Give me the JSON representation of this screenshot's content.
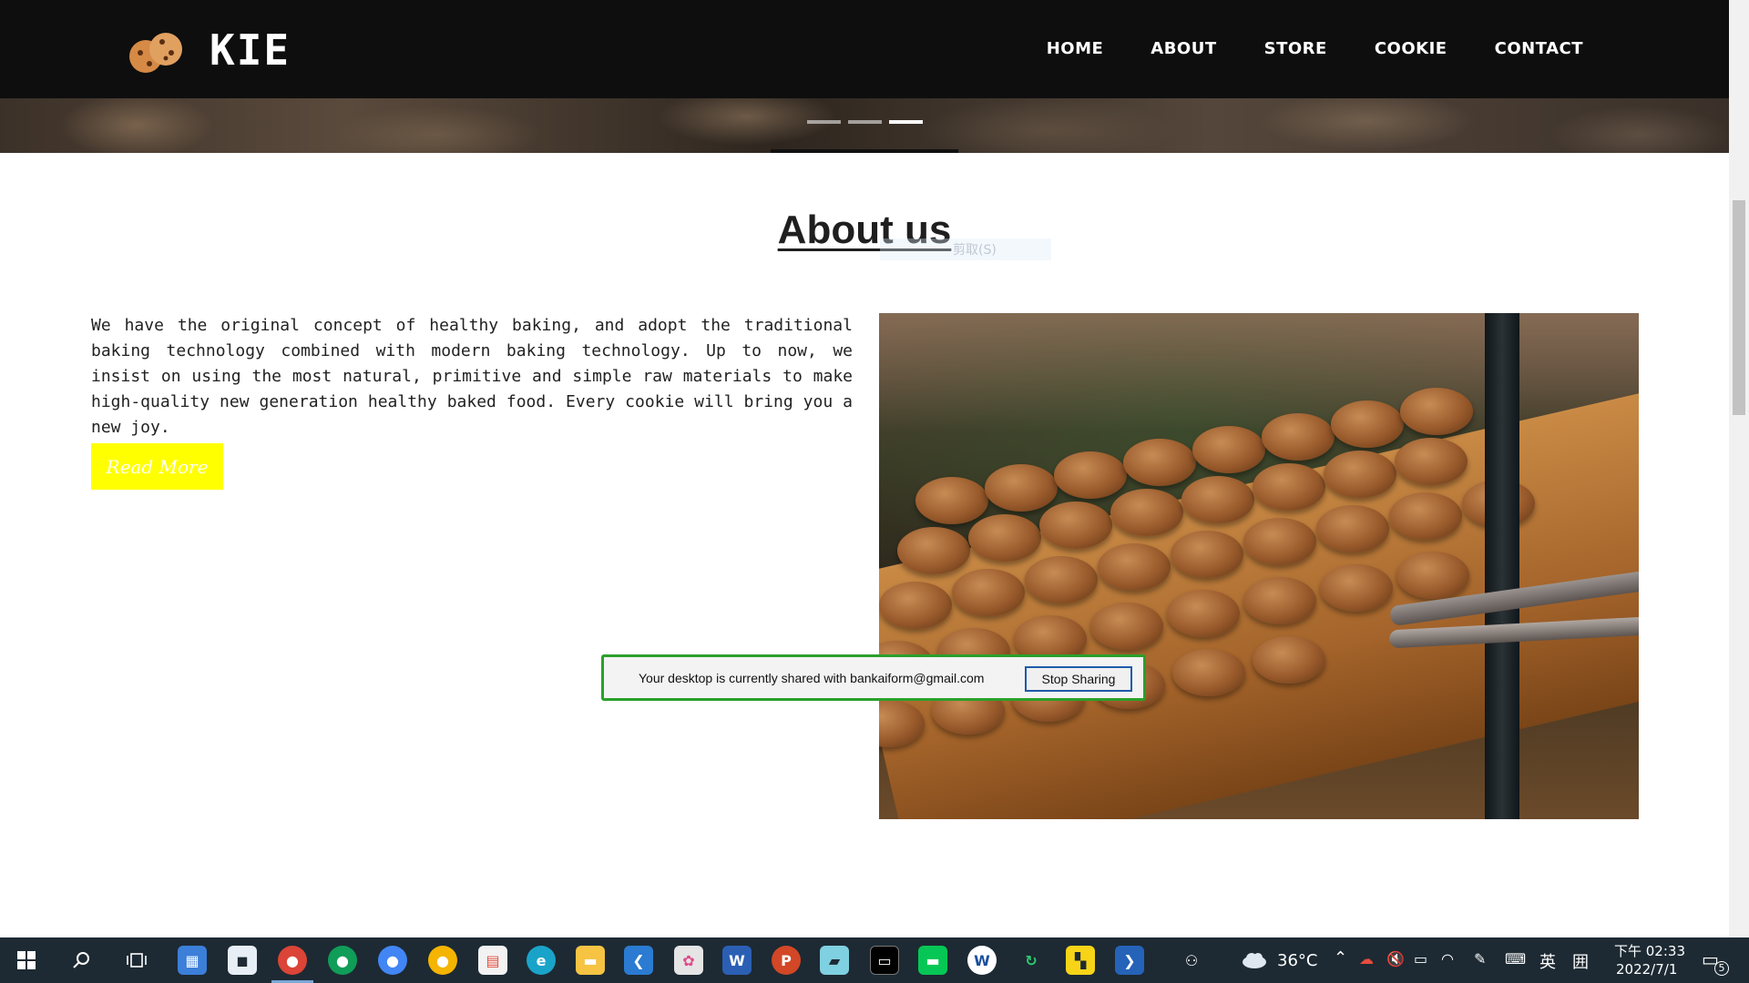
{
  "site": {
    "brand": "KIE",
    "nav": [
      "HOME",
      "ABOUT",
      "STORE",
      "COOKIE",
      "CONTACT"
    ],
    "logo_icon": "cookie-icon"
  },
  "hero": {
    "slides_total": 3,
    "active_slide": 3
  },
  "about": {
    "title": "About us",
    "ghost_tooltip": "剪取(S)",
    "text": "We have the original concept of healthy baking, and adopt the traditional baking technology combined with modern baking technology. Up to now, we insist on using the most natural, primitive and simple raw materials to make high-quality new generation healthy baked food. Every cookie will bring you a new joy.",
    "read_more": "Read More",
    "accent_color": "#ffff00"
  },
  "share_bar": {
    "message": "Your desktop is currently shared with bankaiform@gmail.com",
    "stop_label": "Stop Sharing",
    "border_color": "#2aa02a"
  },
  "taskbar": {
    "weather": "36°C",
    "language": "英",
    "time": "下午 02:33",
    "date": "2022/7/1",
    "notification_count": "5",
    "apps": [
      "start",
      "search",
      "task-view",
      "calendar",
      "app",
      "chrome",
      "chrome",
      "chrome",
      "chrome",
      "store",
      "edge",
      "file-explorer",
      "vscode",
      "paint",
      "word",
      "powerpoint",
      "notes",
      "terminal",
      "line",
      "app",
      "sync",
      "sticky-notes",
      "powershell"
    ]
  }
}
